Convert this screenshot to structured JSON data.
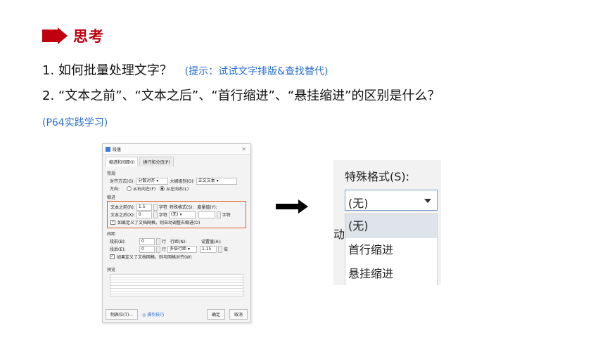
{
  "heading": {
    "title": "思考",
    "accent": "#c0000f"
  },
  "question1": {
    "text": "1. 如何批量处理文字？",
    "hint": "(提示：试试文字排版&查找替代)"
  },
  "question2": {
    "text": "2. “文本之前”、“文本之后”、“首行缩进”、“悬挂缩进”的区别是什么？"
  },
  "reference": "(P64实践学习)",
  "dialog": {
    "title": "段落",
    "tabs": [
      "缩进和间距(I)",
      "换行和分页(P)"
    ],
    "general": {
      "title": "常规",
      "align_label": "对齐方式(G):",
      "align_value": "分散对齐",
      "outline_label": "大纲级别(O):",
      "outline_value": "正文文本",
      "direction_label": "方向:",
      "rtl_label": "从右向左(F)",
      "ltr_label": "从左向右(L)"
    },
    "indent": {
      "title": "缩进",
      "before_label": "文本之前(R):",
      "before_value": "1.5",
      "before_unit": "字符",
      "after_label": "文本之后(X):",
      "after_value": "0",
      "after_unit": "字符",
      "special_label": "特殊格式(S):",
      "special_value": "(无)",
      "measure_label": "度量值(Y):",
      "measure_unit": "字符",
      "auto_check": "如果定义了文档网格，则自动调整右缩进(D)"
    },
    "spacing": {
      "title": "间距",
      "before_label": "段前(B):",
      "before_value": "0",
      "before_unit": "行",
      "after_label": "段后(E):",
      "after_value": "0",
      "after_unit": "行",
      "line_label": "行距(N):",
      "line_value": "多倍行距",
      "set_label": "设置值(A):",
      "set_value": "1.15",
      "set_unit": "倍",
      "grid_check": "如果定义了文档网格，则与网格对齐(W)"
    },
    "preview_title": "预览",
    "tabstops_button": "制表位(T)...",
    "tips_link": "操作技巧",
    "ok_button": "确定",
    "cancel_button": "取消"
  },
  "zoom": {
    "label": "特殊格式(S):",
    "selected": "(无)",
    "behind_text": "动",
    "options": [
      "(无)",
      "首行缩进",
      "悬挂缩进"
    ]
  }
}
